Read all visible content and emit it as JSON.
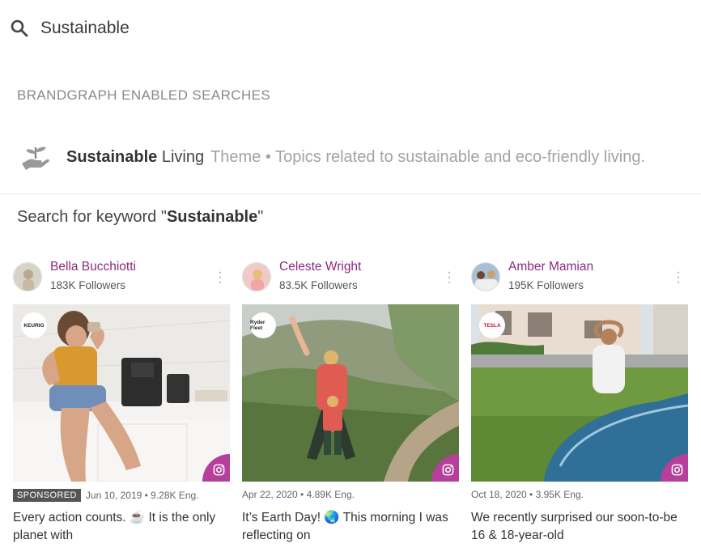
{
  "search": {
    "value": "Sustainable"
  },
  "section_header": "BRANDGRAPH ENABLED SEARCHES",
  "suggestion": {
    "title_bold": "Sustainable",
    "title_rest": " Living",
    "meta": "Theme • Topics related to sustainable and eco-friendly living."
  },
  "keyword_search": {
    "prefix": "Search for keyword \"",
    "term": "Sustainable",
    "suffix": "\""
  },
  "cards": [
    {
      "name": "Bella Bucchiotti",
      "followers": "183K Followers",
      "brand": "KEURIG",
      "sponsored": "SPONSORED",
      "meta": "Jun 10, 2019 • 9.28K Eng.",
      "caption": "Every action counts. ☕  It is the only planet with"
    },
    {
      "name": "Celeste Wright",
      "followers": "83.5K Followers",
      "brand": "Ryder Fleet",
      "meta": "Apr 22, 2020 • 4.89K Eng.",
      "caption": "It’s Earth Day! 🌏  This morning I was reflecting on"
    },
    {
      "name": "Amber Mamian",
      "followers": "195K Followers",
      "brand": "TESLA",
      "meta": "Oct 18, 2020 • 3.95K Eng.",
      "caption": "We recently surprised our soon-to-be 16 & 18-year-old"
    }
  ],
  "colors": {
    "accent": "#8b2a7f",
    "instagram_badge": "#b4409a",
    "muted_text": "#a3a3a3"
  },
  "icons": [
    "search-icon",
    "sustainable-hand-icon",
    "more-options-icon",
    "instagram-icon"
  ]
}
